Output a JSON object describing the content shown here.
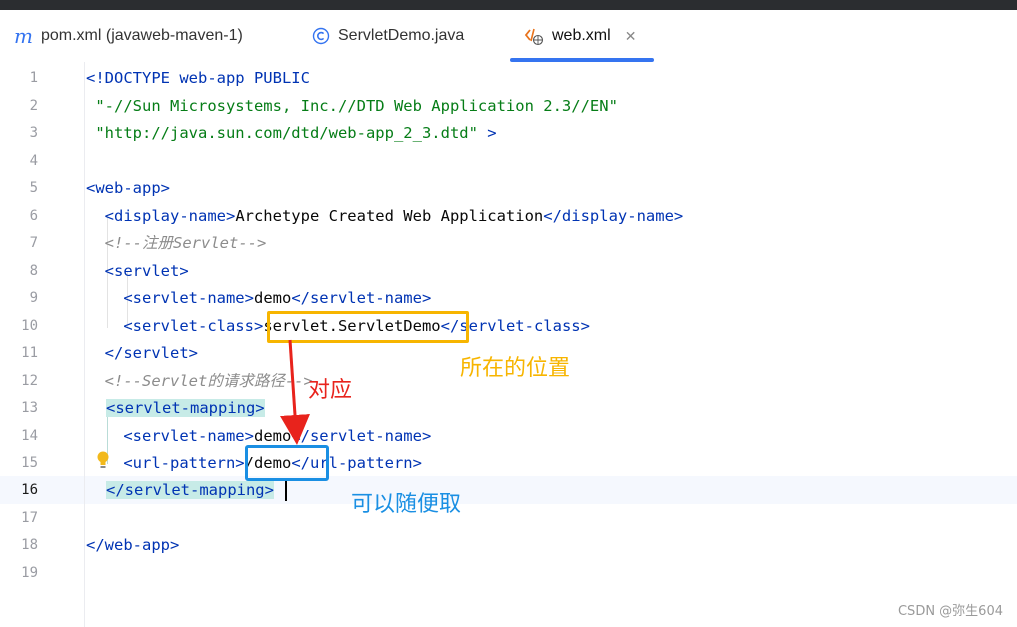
{
  "tabs": [
    {
      "label": "pom.xml (javaweb-maven-1)",
      "icon": "maven-icon"
    },
    {
      "label": "ServletDemo.java",
      "icon": "java-class-icon"
    },
    {
      "label": "web.xml",
      "icon": "xml-file-icon",
      "active": true,
      "close": "✕"
    }
  ],
  "editor": {
    "line_numbers": [
      "1",
      "2",
      "3",
      "4",
      "5",
      "6",
      "7",
      "8",
      "9",
      "10",
      "11",
      "12",
      "13",
      "14",
      "15",
      "16",
      "17",
      "18",
      "19"
    ],
    "current_line": "16",
    "lines": {
      "l1a": "<!DOCTYPE web-app PUBLIC",
      "l2a": " \"-//Sun Microsystems, Inc.//DTD Web Application 2.3//EN\"",
      "l3a": " \"http://java.sun.com/dtd/web-app_2_3.dtd\"",
      "l3b": " >",
      "l5a": "<web-app>",
      "l6a": "  <display-name>",
      "l6b": "Archetype Created Web Application",
      "l6c": "</display-name>",
      "l7a": "  <!--注册Servlet-->",
      "l8a": "  <servlet>",
      "l9a": "    <servlet-name>",
      "l9b": "demo",
      "l9c": "</servlet-name>",
      "l10a": "    <servlet-class>",
      "l10b": "servlet.ServletDemo",
      "l10c": "</servlet-class>",
      "l11a": "  </servlet>",
      "l12a": "  <!--Servlet的请求路径-->",
      "l13a": "<servlet-mapping>",
      "l14a": "    <servlet-name>",
      "l14b": "demo",
      "l14c": "</servlet-name>",
      "l15a": "    <url-pattern>",
      "l15b": "/demo",
      "l15c": "</url-pattern>",
      "l16a": "</servlet-mapping>",
      "l18a": "</web-app>"
    }
  },
  "annotations": {
    "location": "所在的位置",
    "correspond": "对应",
    "arbitrary": "可以随便取"
  },
  "colors": {
    "accent": "#3574f0",
    "tag": "#0033b3",
    "string": "#067d17",
    "comment": "#8c8c8c",
    "box_yellow": "#f7b500",
    "box_blue": "#1a8fe3",
    "arrow_red": "#e8231c"
  },
  "watermark": "CSDN @弥生604"
}
